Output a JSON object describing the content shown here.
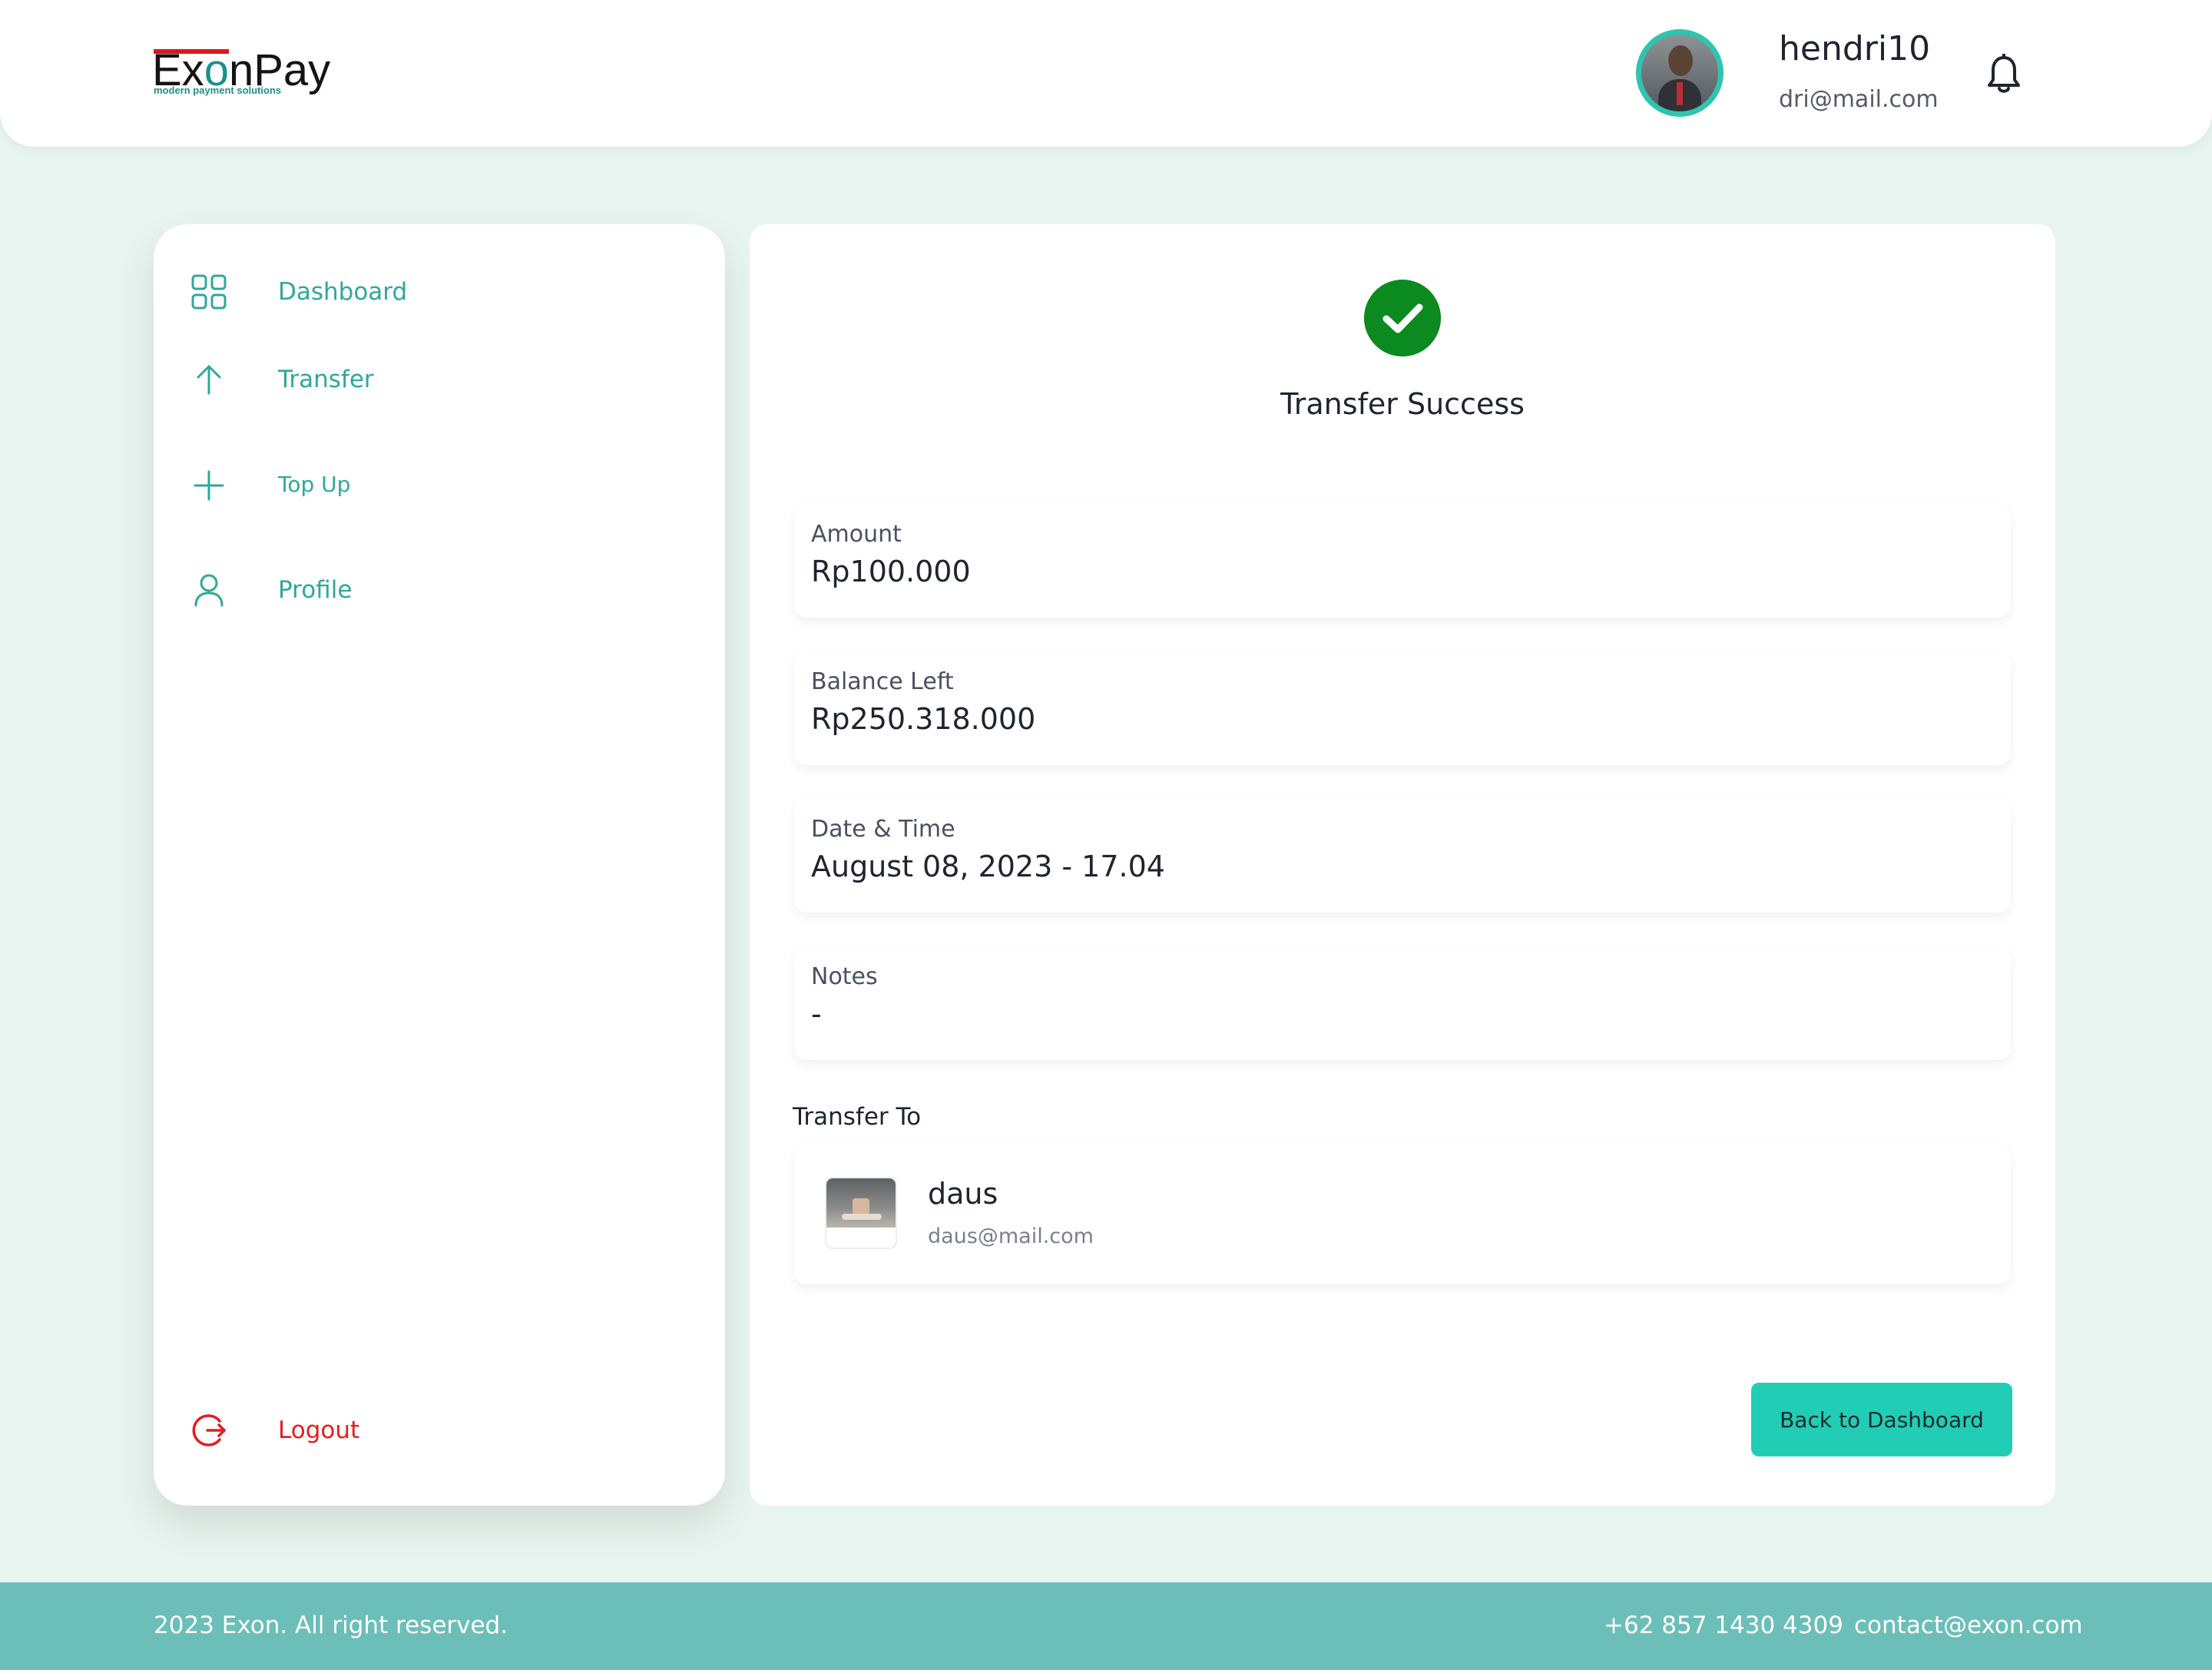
{
  "header": {
    "logo": {
      "brand_text": "ExonPay",
      "tagline": "modern payment solutions"
    },
    "user": {
      "username": "hendri10",
      "email": "dri@mail.com"
    },
    "icons": {
      "notification": "bell-icon"
    }
  },
  "sidebar": {
    "items": [
      {
        "label": "Dashboard",
        "icon": "grid-icon"
      },
      {
        "label": "Transfer",
        "icon": "arrow-up-icon"
      },
      {
        "label": "Top Up",
        "icon": "plus-icon"
      },
      {
        "label": "Profile",
        "icon": "user-icon"
      }
    ],
    "logout": {
      "label": "Logout",
      "icon": "logout-icon"
    }
  },
  "main": {
    "status_icon": "check-circle-icon",
    "title": "Transfer Success",
    "details": [
      {
        "label": "Amount",
        "value": "Rp100.000"
      },
      {
        "label": "Balance Left",
        "value": "Rp250.318.000"
      },
      {
        "label": "Date & Time",
        "value": "August 08, 2023 - 17.04"
      },
      {
        "label": "Notes",
        "value": "-"
      }
    ],
    "transfer_to": {
      "heading": "Transfer To",
      "name": "daus",
      "email": "daus@mail.com"
    },
    "back_button": "Back to Dashboard"
  },
  "footer": {
    "copyright": "2023 Exon. All right reserved.",
    "phone": "+62 857 1430 4309",
    "email": "contact@exon.com"
  },
  "colors": {
    "accent": "#22cdb6",
    "nav_text": "#2fa89a",
    "logout": "#e81c1c",
    "success": "#0a8a1f",
    "footer_bg": "#6bbfb8",
    "page_bg": "#e8f4ef"
  }
}
